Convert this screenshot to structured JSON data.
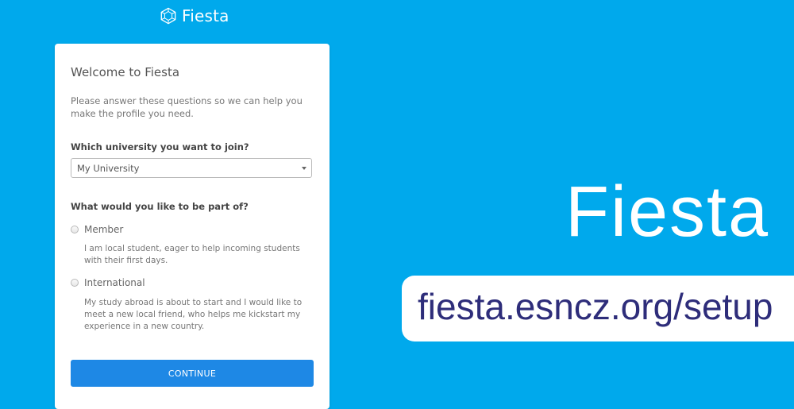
{
  "header": {
    "logo_icon": "hexagon-network-icon",
    "app_name": "Fiesta"
  },
  "form": {
    "title": "Welcome to Fiesta",
    "intro": "Please answer these questions so we can help you make the profile you need.",
    "university_question": "Which university you want to join?",
    "university_select": {
      "value": "My University",
      "caret_icon": "caret-down-icon"
    },
    "role_question": "What would you like to be part of?",
    "options": [
      {
        "label": "Member",
        "description": "I am local student, eager to help incoming students with their first days."
      },
      {
        "label": "International",
        "description": "My study abroad is about to start and I would like to meet a new local friend, who helps me kickstart my experience in a new country."
      }
    ],
    "continue_label": "CONTINUE"
  },
  "promo": {
    "title": "Fiesta",
    "url": "fiesta.esncz.org/setup"
  },
  "colors": {
    "background": "#00a9ec",
    "button": "#1e88e5",
    "url_text": "#2e2d7a"
  }
}
